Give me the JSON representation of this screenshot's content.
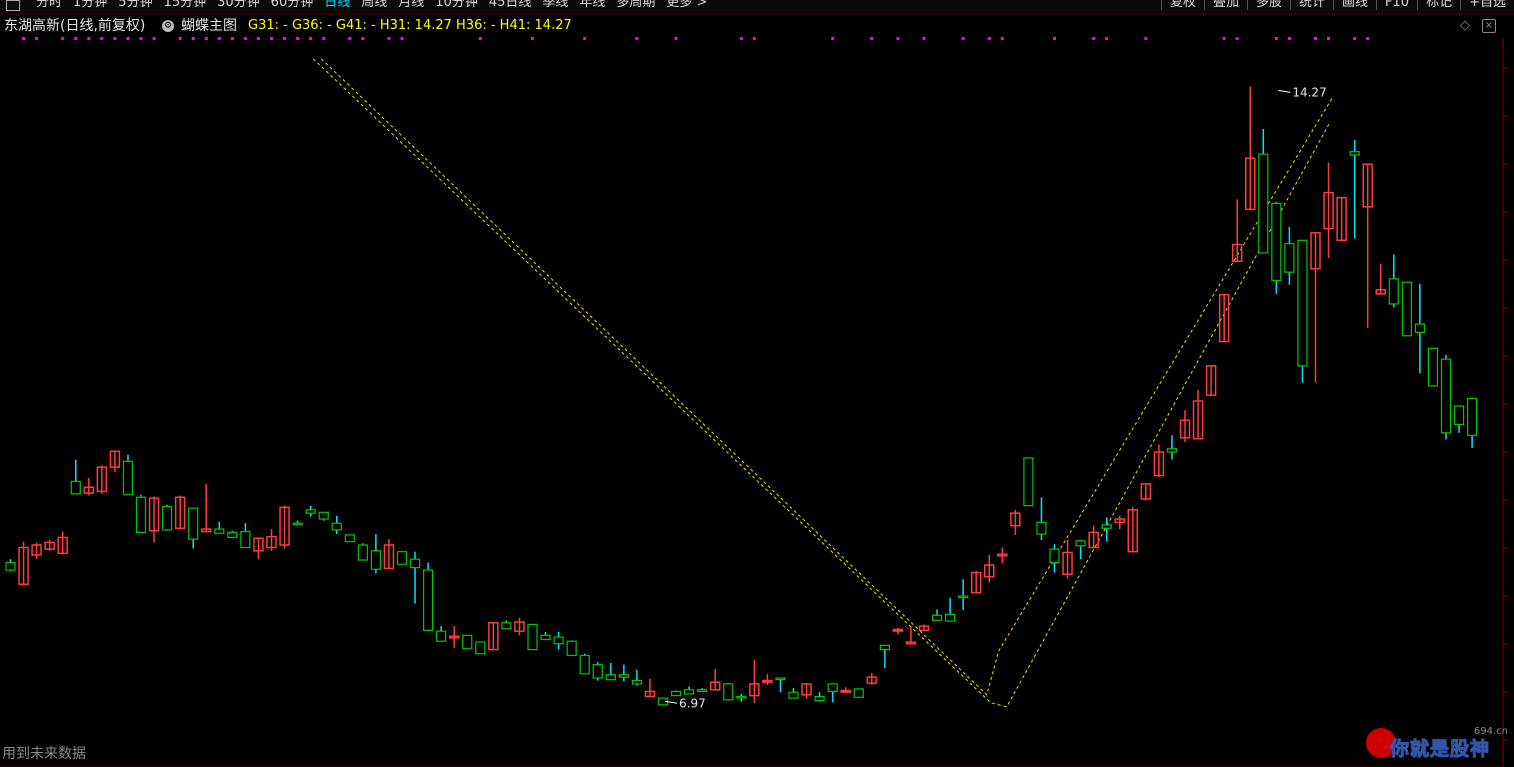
{
  "toolbar": {
    "periods": [
      {
        "label": "分时",
        "active": false
      },
      {
        "label": "1分钟",
        "active": false
      },
      {
        "label": "5分钟",
        "active": false
      },
      {
        "label": "15分钟",
        "active": false
      },
      {
        "label": "30分钟",
        "active": false
      },
      {
        "label": "60分钟",
        "active": false
      },
      {
        "label": "日线",
        "active": true
      },
      {
        "label": "周线",
        "active": false
      },
      {
        "label": "月线",
        "active": false
      },
      {
        "label": "10分钟",
        "active": false
      },
      {
        "label": "45日线",
        "active": false
      },
      {
        "label": "季线",
        "active": false
      },
      {
        "label": "年线",
        "active": false
      },
      {
        "label": "多周期",
        "active": false
      },
      {
        "label": "更多 >",
        "active": false
      }
    ],
    "right_buttons": [
      "复权",
      "叠加",
      "多股",
      "统计",
      "画线",
      "F10",
      "标记",
      "+自选"
    ]
  },
  "info": {
    "stock_label": "东湖高新(日线,前复权)",
    "indicator_name": "蝴蝶主图",
    "indicator_values": "G31: -  G36: -  G41: -  H31: 14.27  H36: -  H41: 14.27"
  },
  "chart_data": {
    "type": "candlestick",
    "ylim": [
      6.4,
      14.8
    ],
    "colors": {
      "up": "#ff3b3b",
      "down": "#00c800",
      "shadow_down": "#00e5ff",
      "dash": "#e8e800",
      "dots": "#ff00ff"
    },
    "candles": [
      [
        8.58,
        8.62,
        8.48,
        8.49
      ],
      [
        8.32,
        8.83,
        8.31,
        8.76
      ],
      [
        8.67,
        8.82,
        8.62,
        8.79
      ],
      [
        8.74,
        8.85,
        8.72,
        8.82
      ],
      [
        8.69,
        8.95,
        8.68,
        8.88
      ],
      [
        9.55,
        9.81,
        9.47,
        9.4
      ],
      [
        9.41,
        9.59,
        9.38,
        9.48
      ],
      [
        9.43,
        9.74,
        9.4,
        9.72
      ],
      [
        9.72,
        9.91,
        9.66,
        9.91
      ],
      [
        9.79,
        9.87,
        9.4,
        9.39
      ],
      [
        9.36,
        9.39,
        8.97,
        8.94
      ],
      [
        8.96,
        9.37,
        8.82,
        9.35
      ],
      [
        9.25,
        9.27,
        8.96,
        8.97
      ],
      [
        8.99,
        9.38,
        8.98,
        9.36
      ],
      [
        9.23,
        9.23,
        8.75,
        8.86
      ],
      [
        8.95,
        9.52,
        8.96,
        8.98
      ],
      [
        8.98,
        9.07,
        8.93,
        8.93
      ],
      [
        8.94,
        8.96,
        8.87,
        8.88
      ],
      [
        8.95,
        9.05,
        8.79,
        8.76
      ],
      [
        8.72,
        8.84,
        8.62,
        8.87
      ],
      [
        8.76,
        8.98,
        8.72,
        8.89
      ],
      [
        8.79,
        9.26,
        8.75,
        9.24
      ],
      [
        9.05,
        9.08,
        9.03,
        9.04
      ],
      [
        9.21,
        9.26,
        9.13,
        9.17
      ],
      [
        9.18,
        9.16,
        9.08,
        9.1
      ],
      [
        9.05,
        9.14,
        8.92,
        8.97
      ],
      [
        8.91,
        8.91,
        8.86,
        8.83
      ],
      [
        8.79,
        8.81,
        8.78,
        8.61
      ],
      [
        8.72,
        8.92,
        8.45,
        8.5
      ],
      [
        8.51,
        8.86,
        8.53,
        8.79
      ],
      [
        8.71,
        8.7,
        8.62,
        8.56
      ],
      [
        8.62,
        8.71,
        8.09,
        8.52
      ],
      [
        8.49,
        8.58,
        7.93,
        7.77
      ],
      [
        7.76,
        7.82,
        7.7,
        7.64
      ],
      [
        7.68,
        7.82,
        7.56,
        7.7
      ],
      [
        7.71,
        7.69,
        7.61,
        7.55
      ],
      [
        7.63,
        7.63,
        7.51,
        7.49
      ],
      [
        7.54,
        7.87,
        7.53,
        7.86
      ],
      [
        7.86,
        7.89,
        7.8,
        7.79
      ],
      [
        7.76,
        7.92,
        7.71,
        7.87
      ],
      [
        7.84,
        7.8,
        7.58,
        7.54
      ],
      [
        7.71,
        7.75,
        7.67,
        7.66
      ],
      [
        7.69,
        7.75,
        7.54,
        7.61
      ],
      [
        7.64,
        7.65,
        7.53,
        7.47
      ],
      [
        7.47,
        7.49,
        7.28,
        7.25
      ],
      [
        7.36,
        7.39,
        7.17,
        7.2
      ],
      [
        7.24,
        7.38,
        7.25,
        7.18
      ],
      [
        7.24,
        7.36,
        7.16,
        7.21
      ],
      [
        7.17,
        7.3,
        7.11,
        7.13
      ],
      [
        6.98,
        7.19,
        7.06,
        7.04
      ],
      [
        6.96,
        6.91,
        6.93,
        6.88
      ],
      [
        7.04,
        7.05,
        7.03,
        6.99
      ],
      [
        7.06,
        7.1,
        7.02,
        7.01
      ],
      [
        7.06,
        7.08,
        7.05,
        7.04
      ],
      [
        7.06,
        7.31,
        7.06,
        7.15
      ],
      [
        7.13,
        7.14,
        6.93,
        6.94
      ],
      [
        6.98,
        7.01,
        6.92,
        6.97
      ],
      [
        6.99,
        7.42,
        6.9,
        7.13
      ],
      [
        7.15,
        7.25,
        7.12,
        7.17
      ],
      [
        7.2,
        7.07,
        7.03,
        7.19
      ],
      [
        7.03,
        7.08,
        7.03,
        6.96
      ],
      [
        7.0,
        7.03,
        6.95,
        7.13
      ],
      [
        6.98,
        7.03,
        6.97,
        6.93
      ],
      [
        7.13,
        7.09,
        6.91,
        7.04
      ],
      [
        7.04,
        7.09,
        7.05,
        7.05
      ],
      [
        7.07,
        7.03,
        7.0,
        6.97
      ],
      [
        7.14,
        7.26,
        7.12,
        7.21
      ],
      [
        7.59,
        7.54,
        7.32,
        7.54
      ],
      [
        7.77,
        7.8,
        7.72,
        7.78
      ],
      [
        7.61,
        7.81,
        7.6,
        7.63
      ],
      [
        7.77,
        7.84,
        7.78,
        7.82
      ],
      [
        7.95,
        8.02,
        7.96,
        7.89
      ],
      [
        7.96,
        8.16,
        7.91,
        7.88
      ],
      [
        8.18,
        8.38,
        8.01,
        8.17
      ],
      [
        8.22,
        8.48,
        8.21,
        8.46
      ],
      [
        8.41,
        8.67,
        8.34,
        8.55
      ],
      [
        8.66,
        8.76,
        8.57,
        8.68
      ],
      [
        9.02,
        9.21,
        8.91,
        9.17
      ],
      [
        9.83,
        9.62,
        9.4,
        9.26
      ],
      [
        9.06,
        9.36,
        8.85,
        8.92
      ],
      [
        8.74,
        8.8,
        8.46,
        8.58
      ],
      [
        8.44,
        8.85,
        8.39,
        8.7
      ],
      [
        8.84,
        8.85,
        8.62,
        8.78
      ],
      [
        8.76,
        9.02,
        8.81,
        8.94
      ],
      [
        9.03,
        9.12,
        8.83,
        8.99
      ],
      [
        9.06,
        9.14,
        8.98,
        9.1
      ],
      [
        8.71,
        9.24,
        8.99,
        9.21
      ],
      [
        9.34,
        9.52,
        9.32,
        9.52
      ],
      [
        9.62,
        9.99,
        9.6,
        9.9
      ],
      [
        9.94,
        10.1,
        9.81,
        9.9
      ],
      [
        10.07,
        10.4,
        10.02,
        10.28
      ],
      [
        10.06,
        10.64,
        10.2,
        10.51
      ],
      [
        10.58,
        10.9,
        10.7,
        10.93
      ],
      [
        11.22,
        11.67,
        11.28,
        11.78
      ],
      [
        12.18,
        12.92,
        12.17,
        12.38
      ],
      [
        12.8,
        14.27,
        12.81,
        13.41
      ],
      [
        13.46,
        13.76,
        13.04,
        12.28
      ],
      [
        12.87,
        12.89,
        11.79,
        11.95
      ],
      [
        12.39,
        12.59,
        11.9,
        12.05
      ],
      [
        12.43,
        11.25,
        10.73,
        10.93
      ],
      [
        12.09,
        12.44,
        10.73,
        12.52
      ],
      [
        12.57,
        13.36,
        12.22,
        13.0
      ],
      [
        12.43,
        12.9,
        12.84,
        12.94
      ],
      [
        13.49,
        13.63,
        12.45,
        13.45
      ],
      [
        12.83,
        13.24,
        11.38,
        13.34
      ],
      [
        11.79,
        12.15,
        11.91,
        11.84
      ],
      [
        11.97,
        12.26,
        11.63,
        11.67
      ],
      [
        11.93,
        11.74,
        11.57,
        11.29
      ],
      [
        11.43,
        11.91,
        10.84,
        11.33
      ],
      [
        11.14,
        11.08,
        10.78,
        10.69
      ],
      [
        11.01,
        11.06,
        10.05,
        10.13
      ],
      [
        10.45,
        10.08,
        10.13,
        10.23
      ],
      [
        10.54,
        10.53,
        9.95,
        10.1
      ]
    ],
    "annotations": [
      {
        "label": "14.27",
        "price": 14.27,
        "index": 97
      },
      {
        "label": "6.97",
        "price": 6.97,
        "index": 50
      }
    ],
    "pattern_points": [
      {
        "index": 24,
        "price": 14.6
      },
      {
        "index": 75,
        "price": 7.0
      },
      {
        "index": 101,
        "price": 14.2
      }
    ]
  },
  "footer": {
    "note": "用到未来数据",
    "logo_text": "你就是股神",
    "logo_site": "694.cn"
  }
}
